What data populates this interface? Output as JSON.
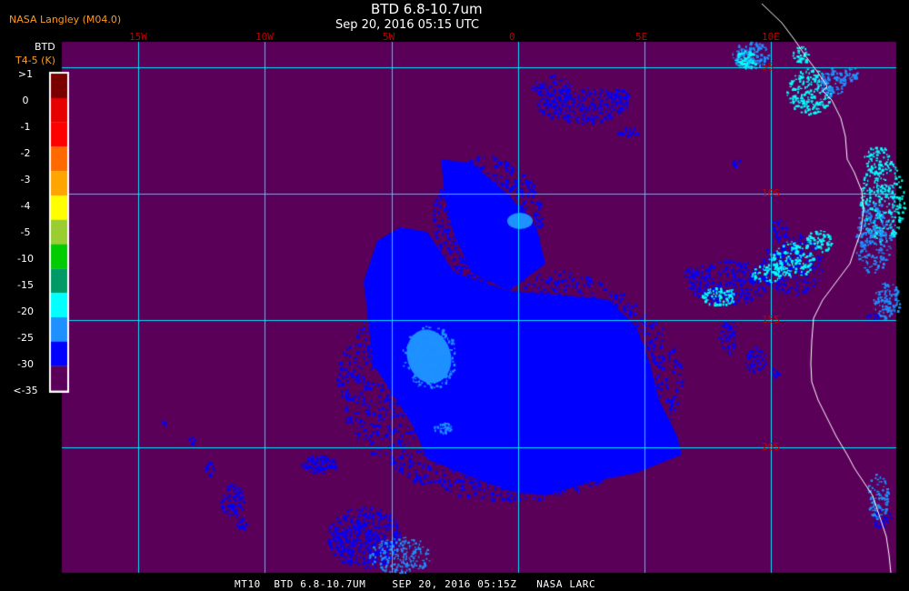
{
  "header": {
    "title": "BTD 6.8-10.7um",
    "datetime": "Sep 20, 2016 05:15 UTC",
    "source": "NASA Langley (M04.0)"
  },
  "colorbar": {
    "title_line1": "BTD",
    "title_line2": "T4-5 (K)",
    "labels": [
      ">1",
      "0",
      "-1",
      "-2",
      "-3",
      "-4",
      "-5",
      "-10",
      "-15",
      "-20",
      "-25",
      "-30",
      "<-35"
    ],
    "colors": [
      "#7a0000",
      "#e60000",
      "#ff0000",
      "#ff6a00",
      "#ffa500",
      "#ffff00",
      "#9acd32",
      "#00cc00",
      "#009a66",
      "#00ffff",
      "#1e90ff",
      "#0000ff",
      "#5a0058"
    ]
  },
  "grid": {
    "lon_labels": [
      "15W",
      "10W",
      "5W",
      "0",
      "5E",
      "10E"
    ],
    "lat_labels": [
      "5S",
      "10S",
      "15S",
      "20S"
    ],
    "line_color": "#00e5ff",
    "label_color": "#c00000"
  },
  "map": {
    "background_color": "#5a0058",
    "cloud_colors": [
      "#0000ff",
      "#1e90ff",
      "#00ffff"
    ],
    "coastline_color": "#ffffff"
  },
  "footer": {
    "text": "MT10  BTD 6.8-10.7UM    SEP 20, 2016 05:15Z   NASA LARC"
  }
}
